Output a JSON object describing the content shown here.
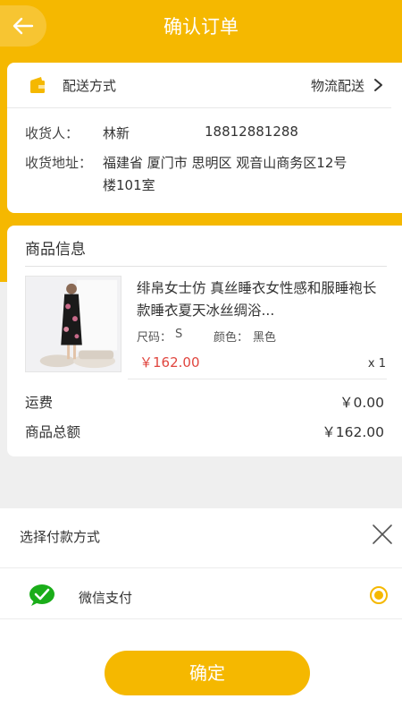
{
  "header": {
    "title": "确认订单",
    "back_icon": "arrow-left-icon"
  },
  "colors": {
    "accent": "#f5b800",
    "price": "#e0463f",
    "wechat_green": "#1aad19"
  },
  "delivery": {
    "method_label": "配送方式",
    "method_value": "物流配送",
    "receiver_label": "收货人：",
    "receiver_name": "林新",
    "receiver_phone": "18812881288",
    "address_label": "收货地址：",
    "address_line1": "福建省 厦门市 思明区 观音山商务区12号",
    "address_line2": "楼101室"
  },
  "product": {
    "section_title": "商品信息",
    "name": "绯帛女士仿 真丝睡衣女性感和服睡袍长款睡衣夏天冰丝绸浴...",
    "size_label": "尺码：",
    "size_value": "S",
    "color_label": "颜色：",
    "color_value": "黑色",
    "price": "￥162.00",
    "quantity": "x 1"
  },
  "summary": {
    "shipping_label": "运费",
    "shipping_value": "￥0.00",
    "total_label": "商品总额",
    "total_value": "￥162.00"
  },
  "payment": {
    "title": "选择付款方式",
    "close_icon": "close-icon",
    "method_name": "微信支付",
    "method_icon": "wechat-icon",
    "selected": true,
    "confirm_label": "确定"
  }
}
